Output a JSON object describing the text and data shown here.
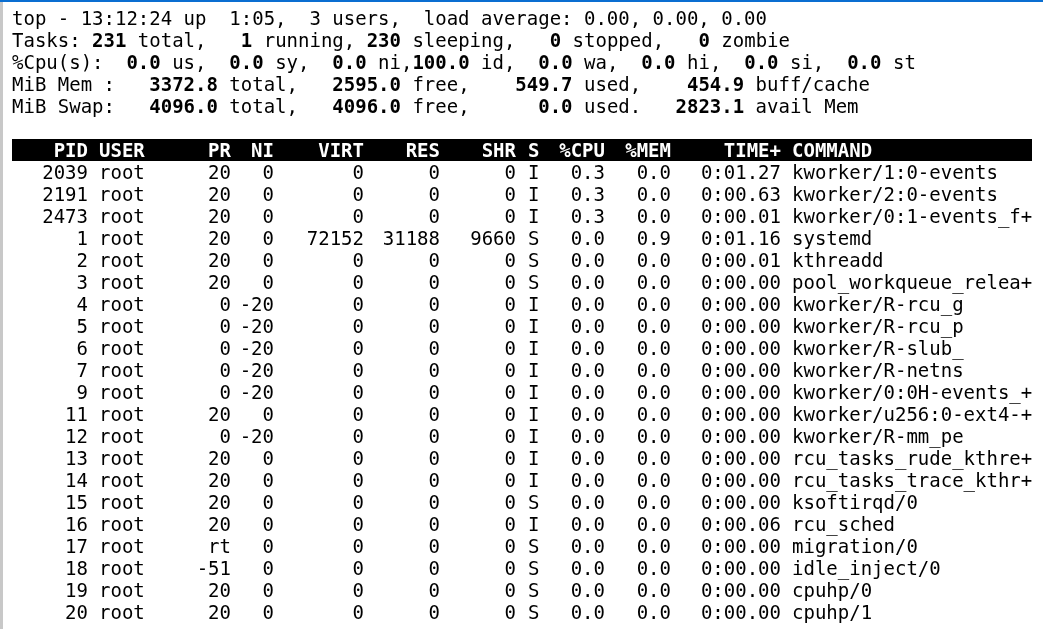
{
  "summary": [
    "top - 13:12:24 up  1:05,  3 users,  load average: 0.00, 0.00, 0.00",
    "Tasks: **231** total,   **1** running, **230** sleeping,   **0** stopped,   **0** zombie",
    "%Cpu(s):  **0.0** us,  **0.0** sy,  **0.0** ni,**100.0** id,  **0.0** wa,  **0.0** hi,  **0.0** si,  **0.0** st",
    "MiB Mem :   **3372.8** total,   **2595.0** free,    **549.7** used,    **454.9** buff/cache",
    "MiB Swap:   **4096.0** total,   **4096.0** free,      **0.0** used.   **2823.1** avail Mem"
  ],
  "table": {
    "columns": [
      "PID",
      "USER",
      "PR",
      "NI",
      "VIRT",
      "RES",
      "SHR",
      "S",
      "%CPU",
      "%MEM",
      "TIME+",
      "COMMAND"
    ],
    "rows": [
      [
        "2039",
        "root",
        "20",
        "0",
        "0",
        "0",
        "0",
        "I",
        "0.3",
        "0.0",
        "0:01.27",
        "kworker/1:0-events"
      ],
      [
        "2191",
        "root",
        "20",
        "0",
        "0",
        "0",
        "0",
        "I",
        "0.3",
        "0.0",
        "0:00.63",
        "kworker/2:0-events"
      ],
      [
        "2473",
        "root",
        "20",
        "0",
        "0",
        "0",
        "0",
        "I",
        "0.3",
        "0.0",
        "0:00.01",
        "kworker/0:1-events_f+"
      ],
      [
        "1",
        "root",
        "20",
        "0",
        "72152",
        "31188",
        "9660",
        "S",
        "0.0",
        "0.9",
        "0:01.16",
        "systemd"
      ],
      [
        "2",
        "root",
        "20",
        "0",
        "0",
        "0",
        "0",
        "S",
        "0.0",
        "0.0",
        "0:00.01",
        "kthreadd"
      ],
      [
        "3",
        "root",
        "20",
        "0",
        "0",
        "0",
        "0",
        "S",
        "0.0",
        "0.0",
        "0:00.00",
        "pool_workqueue_relea+"
      ],
      [
        "4",
        "root",
        "0",
        "-20",
        "0",
        "0",
        "0",
        "I",
        "0.0",
        "0.0",
        "0:00.00",
        "kworker/R-rcu_g"
      ],
      [
        "5",
        "root",
        "0",
        "-20",
        "0",
        "0",
        "0",
        "I",
        "0.0",
        "0.0",
        "0:00.00",
        "kworker/R-rcu_p"
      ],
      [
        "6",
        "root",
        "0",
        "-20",
        "0",
        "0",
        "0",
        "I",
        "0.0",
        "0.0",
        "0:00.00",
        "kworker/R-slub_"
      ],
      [
        "7",
        "root",
        "0",
        "-20",
        "0",
        "0",
        "0",
        "I",
        "0.0",
        "0.0",
        "0:00.00",
        "kworker/R-netns"
      ],
      [
        "9",
        "root",
        "0",
        "-20",
        "0",
        "0",
        "0",
        "I",
        "0.0",
        "0.0",
        "0:00.00",
        "kworker/0:0H-events_+"
      ],
      [
        "11",
        "root",
        "20",
        "0",
        "0",
        "0",
        "0",
        "I",
        "0.0",
        "0.0",
        "0:00.00",
        "kworker/u256:0-ext4-+"
      ],
      [
        "12",
        "root",
        "0",
        "-20",
        "0",
        "0",
        "0",
        "I",
        "0.0",
        "0.0",
        "0:00.00",
        "kworker/R-mm_pe"
      ],
      [
        "13",
        "root",
        "20",
        "0",
        "0",
        "0",
        "0",
        "I",
        "0.0",
        "0.0",
        "0:00.00",
        "rcu_tasks_rude_kthre+"
      ],
      [
        "14",
        "root",
        "20",
        "0",
        "0",
        "0",
        "0",
        "I",
        "0.0",
        "0.0",
        "0:00.00",
        "rcu_tasks_trace_kthr+"
      ],
      [
        "15",
        "root",
        "20",
        "0",
        "0",
        "0",
        "0",
        "S",
        "0.0",
        "0.0",
        "0:00.00",
        "ksoftirqd/0"
      ],
      [
        "16",
        "root",
        "20",
        "0",
        "0",
        "0",
        "0",
        "I",
        "0.0",
        "0.0",
        "0:00.06",
        "rcu_sched"
      ],
      [
        "17",
        "root",
        "rt",
        "0",
        "0",
        "0",
        "0",
        "S",
        "0.0",
        "0.0",
        "0:00.00",
        "migration/0"
      ],
      [
        "18",
        "root",
        "-51",
        "0",
        "0",
        "0",
        "0",
        "S",
        "0.0",
        "0.0",
        "0:00.00",
        "idle_inject/0"
      ],
      [
        "19",
        "root",
        "20",
        "0",
        "0",
        "0",
        "0",
        "S",
        "0.0",
        "0.0",
        "0:00.00",
        "cpuhp/0"
      ],
      [
        "20",
        "root",
        "20",
        "0",
        "0",
        "0",
        "0",
        "S",
        "0.0",
        "0.0",
        "0:00.00",
        "cpuhp/1"
      ]
    ]
  }
}
